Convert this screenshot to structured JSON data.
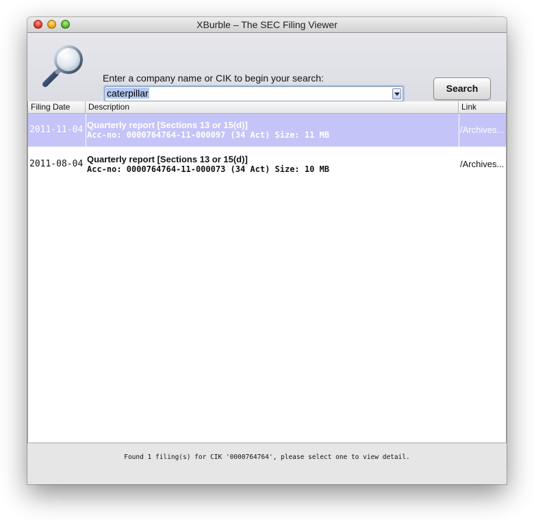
{
  "window": {
    "title": "XBurble – The SEC Filing Viewer"
  },
  "search": {
    "prompt": "Enter a company name or CIK to begin your search:",
    "value": "caterpillar",
    "button_label": "Search"
  },
  "table": {
    "columns": [
      "Filing Date",
      "Description",
      "Link"
    ],
    "rows": [
      {
        "date": "2011-11-04",
        "desc_line1": "Quarterly report [Sections 13 or 15(d)]",
        "desc_line2": "Acc-no: 0000764764-11-000097 (34 Act)  Size: 11 MB",
        "link": "/Archives...",
        "selected": true
      },
      {
        "date": "2011-08-04",
        "desc_line1": "Quarterly report [Sections 13 or 15(d)]",
        "desc_line2": "Acc-no: 0000764764-11-000073 (34 Act)  Size: 10 MB",
        "link": "/Archives...",
        "selected": false
      }
    ]
  },
  "status": {
    "message": "Found 1 filing(s) for CIK '0000764764', please select one to view detail."
  },
  "colors": {
    "selection": "#c4c4f8",
    "panel": "#e0e0e8"
  }
}
